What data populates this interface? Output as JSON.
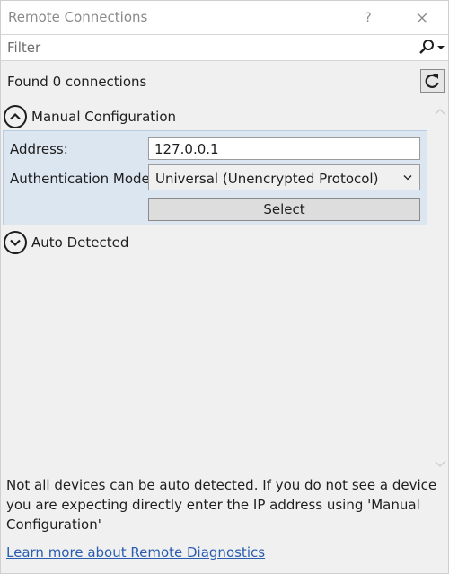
{
  "window": {
    "title": "Remote Connections",
    "help_label": "?",
    "close_icon": "close-icon"
  },
  "filter": {
    "placeholder": "Filter",
    "value": "",
    "search_icon": "search-icon"
  },
  "status": {
    "found_text": "Found 0 connections",
    "refresh_icon": "refresh-icon"
  },
  "manual": {
    "header_label": "Manual Configuration",
    "expanded": true,
    "toggle_icon": "chevron-up-circle-icon",
    "address_label": "Address:",
    "address_value": "127.0.0.1",
    "auth_label": "Authentication Mode:",
    "auth_value": "Universal (Unencrypted Protocol)",
    "select_label": "Select"
  },
  "auto": {
    "header_label": "Auto Detected",
    "expanded": false,
    "toggle_icon": "chevron-down-circle-icon"
  },
  "footer": {
    "note": "Not all devices can be auto detected. If you do not see a device you are expecting directly enter the IP address using 'Manual Configuration'",
    "link_text": "Learn more about Remote Diagnostics"
  },
  "colors": {
    "panel_bg": "#dce6f1",
    "panel_border": "#b8cbe2",
    "link": "#2a5db0",
    "window_bg": "#f0f0f0"
  }
}
